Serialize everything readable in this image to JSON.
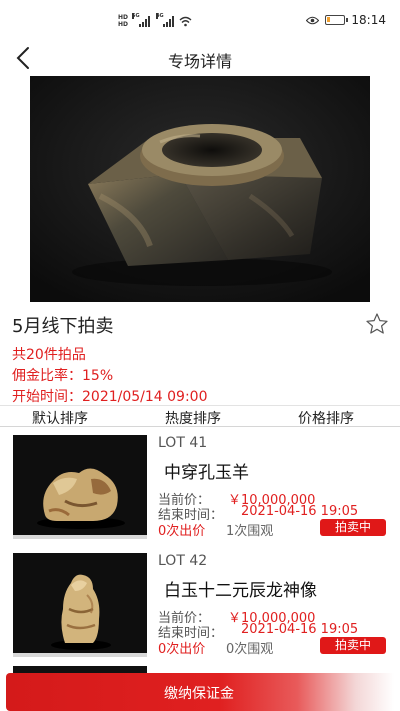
{
  "status_bar": {
    "hd_top": "HD",
    "hd_bottom": "HD",
    "net_1": "5G",
    "net_2": "4G",
    "time": "18:14",
    "battery_level": 0.2
  },
  "nav": {
    "title": "专场详情"
  },
  "auction": {
    "title": "5月线下拍卖",
    "lot_count": "共20件拍品",
    "commission": "佣金比率：15%",
    "start_time": "开始时间：2021/05/14 09:00"
  },
  "sort_tabs": [
    "默认排序",
    "热度排序",
    "价格排序"
  ],
  "lots": [
    {
      "lot_no": "LOT 41",
      "name": "中穿孔玉羊",
      "price_label": "当前价：",
      "price": "￥10,000,000",
      "end_label": "结束时间：",
      "end_time": "2021-04-16 19:05",
      "bids": "0次出价",
      "views": "1次围观",
      "status": "拍卖中"
    },
    {
      "lot_no": "LOT 42",
      "name": "白玉十二元辰龙神像",
      "price_label": "当前价：",
      "price": "￥10,000,000",
      "end_label": "结束时间：",
      "end_time": "2021-04-16 19:05",
      "bids": "0次出价",
      "views": "0次围观",
      "status": "拍卖中"
    }
  ],
  "bottom_button": {
    "label": "缴纳保证金"
  },
  "colors": {
    "accent_red": "#e02020",
    "status_badge": "#e01818"
  },
  "icons": [
    "back-arrow-icon",
    "star-outline-icon",
    "wifi-icon",
    "eye-icon",
    "battery-icon"
  ]
}
